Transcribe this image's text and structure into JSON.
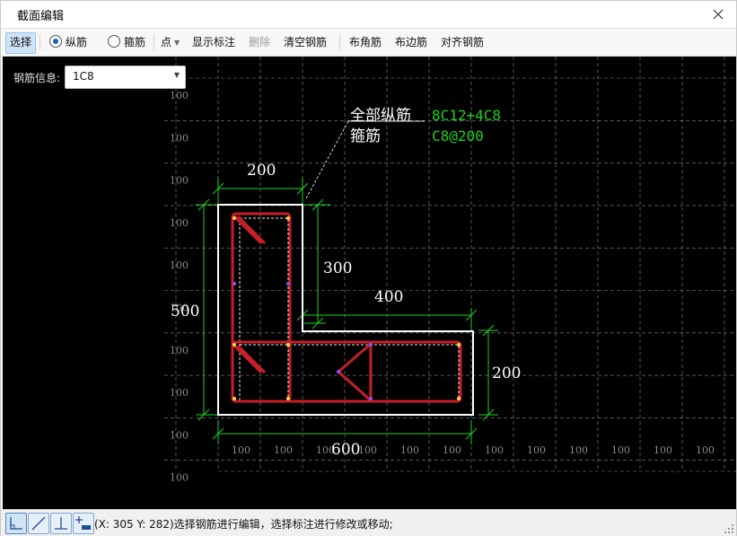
{
  "window": {
    "title": "截面编辑",
    "close_icon": "close-icon"
  },
  "toolbar": {
    "select_label": "选择",
    "longitudinal_label": "纵筋",
    "stirrup_label": "箍筋",
    "point_label": "点",
    "show_annotation_label": "显示标注",
    "delete_label": "删除",
    "clear_rebar_label": "清空钢筋",
    "corner_rebar_label": "布角筋",
    "edge_rebar_label": "布边筋",
    "align_rebar_label": "对齐钢筋",
    "selected_rebar_type": "longitudinal"
  },
  "rebar_info": {
    "label": "钢筋信息:",
    "value": "1C8"
  },
  "canvas": {
    "grid_label": "100",
    "annotation": {
      "all_longitudinal_label": "全部纵筋",
      "all_longitudinal_value": "8C12+4C8",
      "stirrup_label": "箍筋",
      "stirrup_value": "C8@200"
    },
    "dimensions": {
      "top_width": "200",
      "left_height": "500",
      "notch_depth": "300",
      "notch_width": "400",
      "right_height": "200",
      "bottom_width": "600"
    },
    "colors": {
      "background": "#000000",
      "section_outline": "#ffffff",
      "rebar": "#c81e28",
      "dimension": "#1fd01f",
      "annotation_value": "#1fd01f",
      "annotation_text": "#ffffff",
      "grid": "#8a8a8a"
    }
  },
  "statusbar": {
    "coord_text": "(X: 305 Y: 282)选择钢筋进行编辑，选择标注进行修改或移动;",
    "mode_icons": [
      "orthogonal-mode-icon",
      "oblique-mode-icon",
      "perpendicular-mode-icon",
      "add-point-mode-icon"
    ]
  }
}
